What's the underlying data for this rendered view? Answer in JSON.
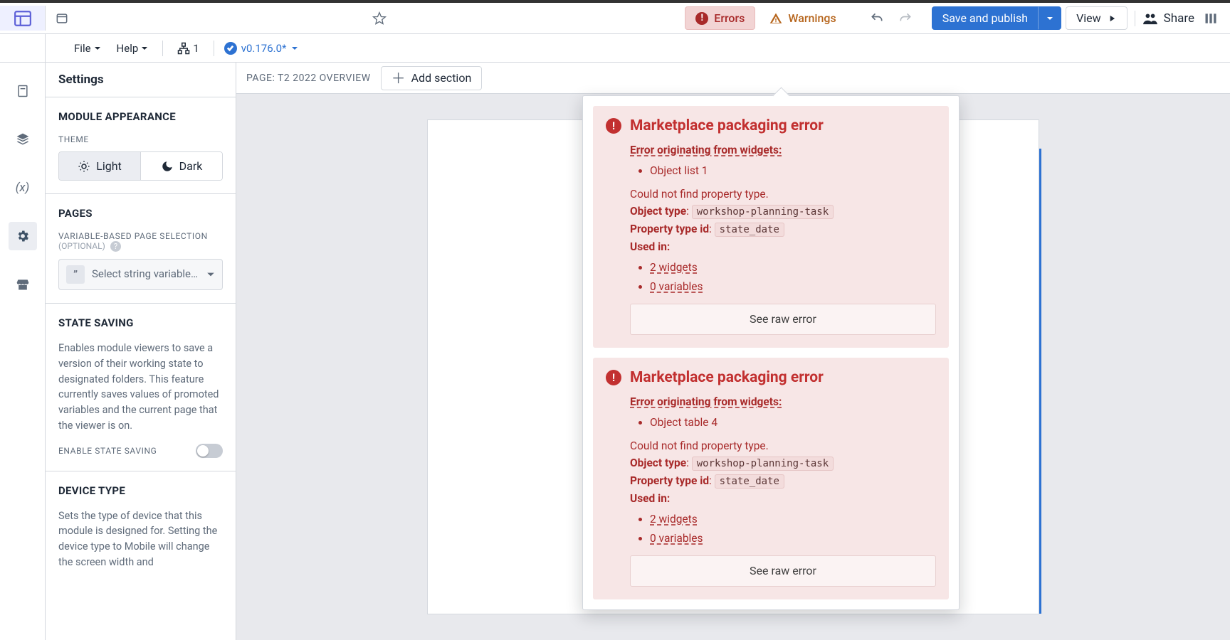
{
  "topbar": {
    "file": "File",
    "help": "Help",
    "workspace_count": "1",
    "version": "v0.176.0*",
    "errors": "Errors",
    "warnings": "Warnings",
    "save_publish": "Save and publish",
    "view": "View",
    "share": "Share"
  },
  "sidebar": {
    "title": "Settings",
    "appearance": {
      "heading": "MODULE APPEARANCE",
      "theme_label": "THEME",
      "light": "Light",
      "dark": "Dark"
    },
    "pages": {
      "heading": "PAGES",
      "var_label": "VARIABLE-BASED PAGE SELECTION",
      "optional": "(OPTIONAL)",
      "select_placeholder": "Select string variable…"
    },
    "state": {
      "heading": "STATE SAVING",
      "desc": "Enables module viewers to save a version of their working state to designated folders. This feature currently saves values of promoted variables and the current page that the viewer is on.",
      "toggle_label": "ENABLE STATE SAVING"
    },
    "device": {
      "heading": "DEVICE TYPE",
      "desc": "Sets the type of device that this module is designed for. Setting the device type to Mobile will change the screen width and"
    }
  },
  "canvas": {
    "page_label": "PAGE: T2 2022 OVERVIEW",
    "add_section": "Add section"
  },
  "errors": [
    {
      "title": "Marketplace packaging error",
      "origin_label": "Error originating from widgets:",
      "origin_items": [
        "Object list 1"
      ],
      "message": "Could not find property type.",
      "object_type_label": "Object type",
      "object_type": "workshop-planning-task",
      "property_label": "Property type id",
      "property": "state_date",
      "used_in_label": "Used in:",
      "used_in": [
        "2 widgets",
        "0 variables"
      ],
      "raw_btn": "See raw error"
    },
    {
      "title": "Marketplace packaging error",
      "origin_label": "Error originating from widgets:",
      "origin_items": [
        "Object table 4"
      ],
      "message": "Could not find property type.",
      "object_type_label": "Object type",
      "object_type": "workshop-planning-task",
      "property_label": "Property type id",
      "property": "state_date",
      "used_in_label": "Used in:",
      "used_in": [
        "2 widgets",
        "0 variables"
      ],
      "raw_btn": "See raw error"
    }
  ]
}
